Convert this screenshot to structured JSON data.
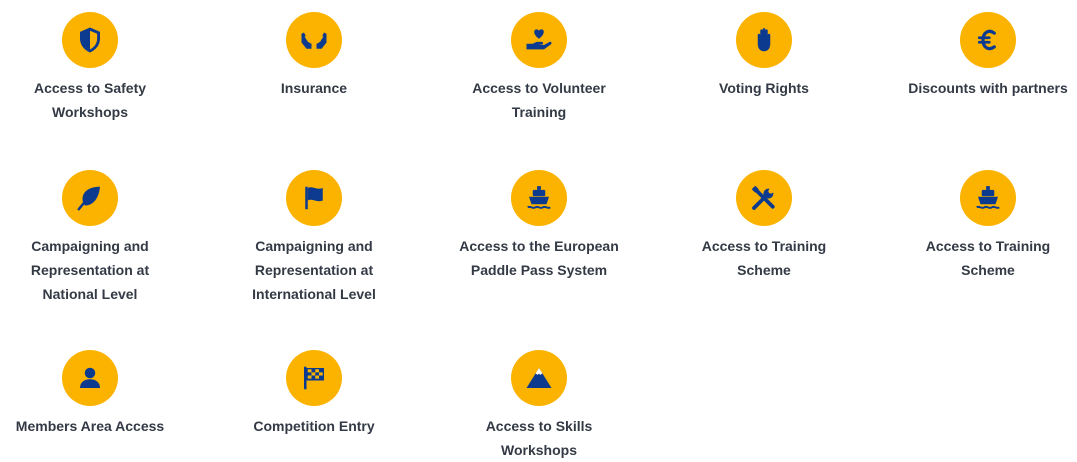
{
  "benefits": [
    {
      "label": "Access to Safety\nWorkshops",
      "icon": "shield-icon"
    },
    {
      "label": "Insurance",
      "icon": "hands-icon"
    },
    {
      "label": "Access to Volunteer\nTraining",
      "icon": "heart-hand-icon"
    },
    {
      "label": "Voting Rights",
      "icon": "raised-hand-icon"
    },
    {
      "label": "Discounts with partners",
      "icon": "euro-icon"
    },
    {
      "label": "Campaigning and\nRepresentation at\nNational Level",
      "icon": "leaf-icon"
    },
    {
      "label": "Campaigning and\nRepresentation at\nInternational Level",
      "icon": "flag-icon"
    },
    {
      "label": "Access to the European\nPaddle Pass System",
      "icon": "ship-icon"
    },
    {
      "label": "Access to Training\nScheme",
      "icon": "tools-icon"
    },
    {
      "label": "Access to Training\nScheme",
      "icon": "ship-icon"
    },
    {
      "label": "Members Area Access",
      "icon": "user-icon"
    },
    {
      "label": "Competition Entry",
      "icon": "checkered-flag-icon"
    },
    {
      "label": "Access to Skills\nWorkshops",
      "icon": "mountain-icon"
    }
  ],
  "colors": {
    "accent": "#fbb300",
    "icon": "#0b3a8f",
    "text": "#333a45"
  }
}
